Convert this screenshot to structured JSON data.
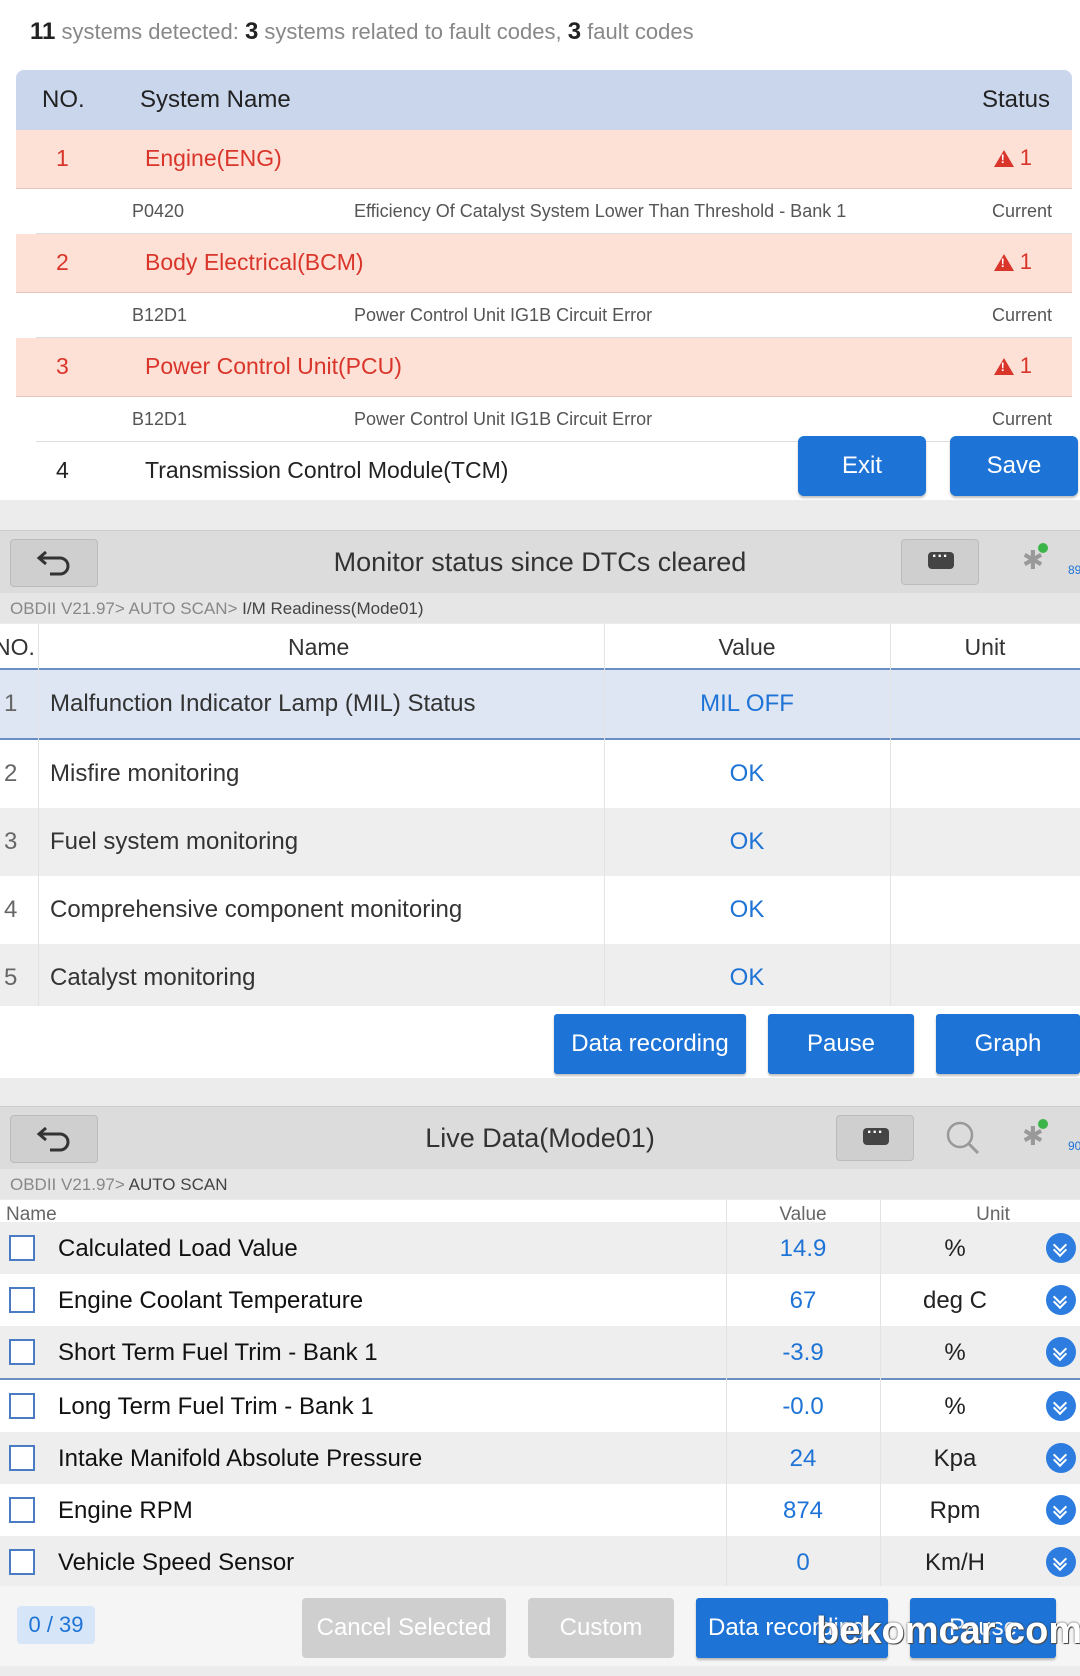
{
  "scan_summary": {
    "systems_count": "11",
    "text1": "systems detected:",
    "related_count": "3",
    "text2": "systems related to fault codes,",
    "fault_count": "3",
    "text3": "fault codes"
  },
  "systems_table": {
    "headers": {
      "no": "NO.",
      "name": "System Name",
      "status": "Status"
    },
    "rows": [
      {
        "no": "1",
        "name": "Engine(ENG)",
        "status": "1",
        "code": "P0420",
        "desc": "Efficiency Of Catalyst System Lower Than Threshold - Bank 1",
        "state": "Current"
      },
      {
        "no": "2",
        "name": "Body Electrical(BCM)",
        "status": "1",
        "code": "B12D1",
        "desc": "Power Control Unit IG1B Circuit Error",
        "state": "Current"
      },
      {
        "no": "3",
        "name": "Power Control Unit(PCU)",
        "status": "1",
        "code": "B12D1",
        "desc": "Power Control Unit IG1B Circuit Error",
        "state": "Current"
      }
    ],
    "row4": {
      "no": "4",
      "name": "Transmission Control Module(TCM)"
    },
    "exit_label": "Exit",
    "save_label": "Save"
  },
  "monitor_panel": {
    "title": "Monitor status since DTCs cleared",
    "breadcrumb": {
      "path": "OBDII V21.97> AUTO SCAN>",
      "current": " I/M Readiness(Mode01)"
    },
    "headers": {
      "no": "NO.",
      "name": "Name",
      "value": "Value",
      "unit": "Unit"
    },
    "rows": [
      {
        "no": "1",
        "name": "Malfunction Indicator Lamp (MIL) Status",
        "value": "MIL OFF"
      },
      {
        "no": "2",
        "name": "Misfire monitoring",
        "value": "OK"
      },
      {
        "no": "3",
        "name": "Fuel system monitoring",
        "value": "OK"
      },
      {
        "no": "4",
        "name": "Comprehensive component monitoring",
        "value": "OK"
      },
      {
        "no": "5",
        "name": "Catalyst monitoring",
        "value": "OK"
      }
    ],
    "buttons": {
      "record": "Data recording",
      "pause": "Pause",
      "graph": "Graph"
    },
    "battery_text": "89"
  },
  "live_panel": {
    "title": "Live Data(Mode01)",
    "breadcrumb": {
      "path": "OBDII V21.97>",
      "current": " AUTO SCAN"
    },
    "headers": {
      "name": "Name",
      "value": "Value",
      "unit": "Unit"
    },
    "rows": [
      {
        "name": "Calculated Load Value",
        "value": "14.9",
        "unit": "%"
      },
      {
        "name": "Engine Coolant Temperature",
        "value": "67",
        "unit": "deg C"
      },
      {
        "name": "Short Term Fuel Trim - Bank 1",
        "value": "-3.9",
        "unit": "%"
      },
      {
        "name": "Long Term Fuel Trim - Bank 1",
        "value": "-0.0",
        "unit": "%"
      },
      {
        "name": "Intake Manifold Absolute Pressure",
        "value": "24",
        "unit": "Kpa"
      },
      {
        "name": "Engine RPM",
        "value": "874",
        "unit": "Rpm"
      },
      {
        "name": "Vehicle Speed Sensor",
        "value": "0",
        "unit": "Km/H"
      }
    ],
    "pager": "0 / 39",
    "buttons": {
      "cancel": "Cancel Selected",
      "custom": "Custom",
      "record": "Data recording",
      "pause": "Pause"
    },
    "battery_text": "90"
  },
  "watermark": "bekomcar.com",
  "colors": {
    "accent": "#1e73d6",
    "fault_bg": "#fde0d6",
    "fault_text": "#d9352a",
    "header_blue": "#c9d6ec"
  }
}
